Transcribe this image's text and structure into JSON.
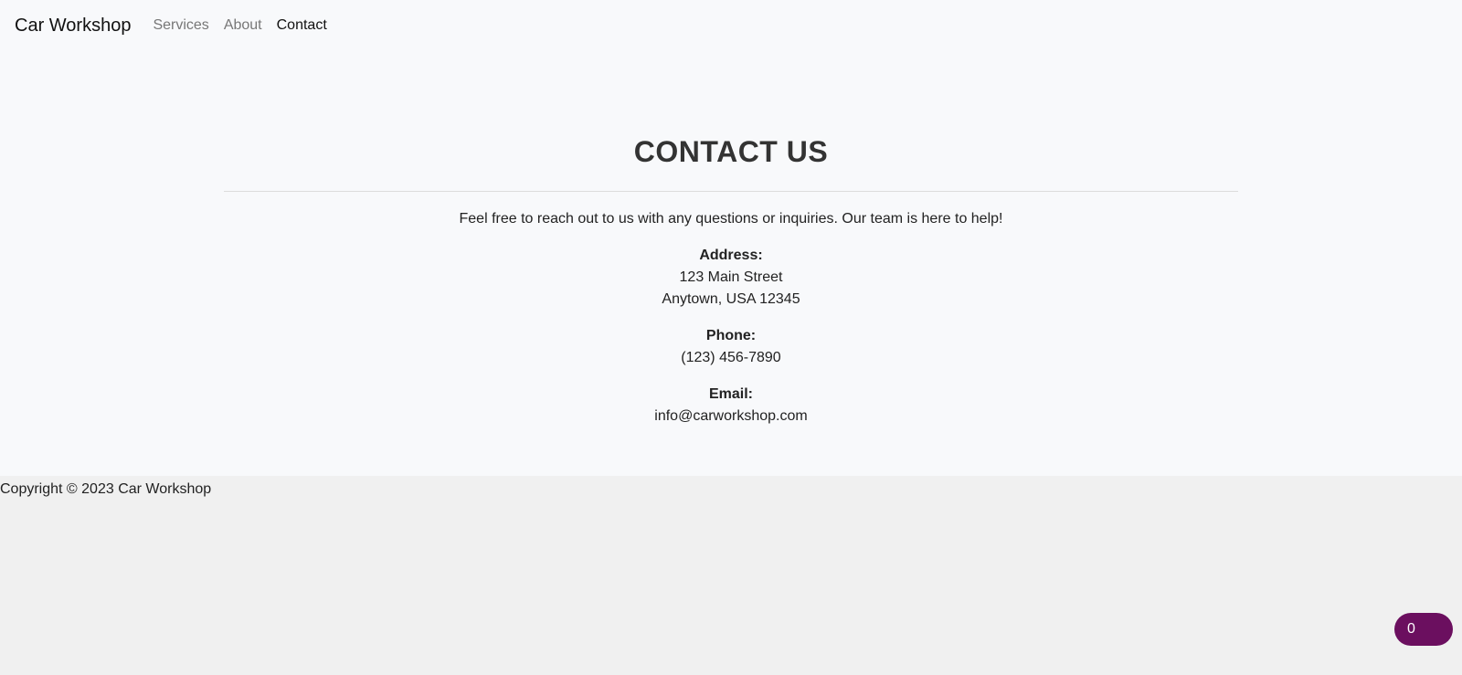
{
  "nav": {
    "brand": "Car Workshop",
    "links": [
      "Services",
      "About",
      "Contact"
    ],
    "active": "Contact"
  },
  "main": {
    "title": "CONTACT US",
    "intro": "Feel free to reach out to us with any questions or inquiries. Our team is here to help!",
    "address": {
      "label": "Address:",
      "line1": "123 Main Street",
      "line2": "Anytown, USA 12345"
    },
    "phone": {
      "label": "Phone:",
      "value": "(123) 456-7890"
    },
    "email": {
      "label": "Email:",
      "value": "info@carworkshop.com"
    }
  },
  "footer": {
    "copyright": "Copyright © 2023 Car Workshop"
  },
  "badge": {
    "count": "0"
  },
  "colors": {
    "badge_bg": "#6b0f5f",
    "page_bg": "#f8f9fb",
    "footer_bg": "#f0f0f0"
  }
}
